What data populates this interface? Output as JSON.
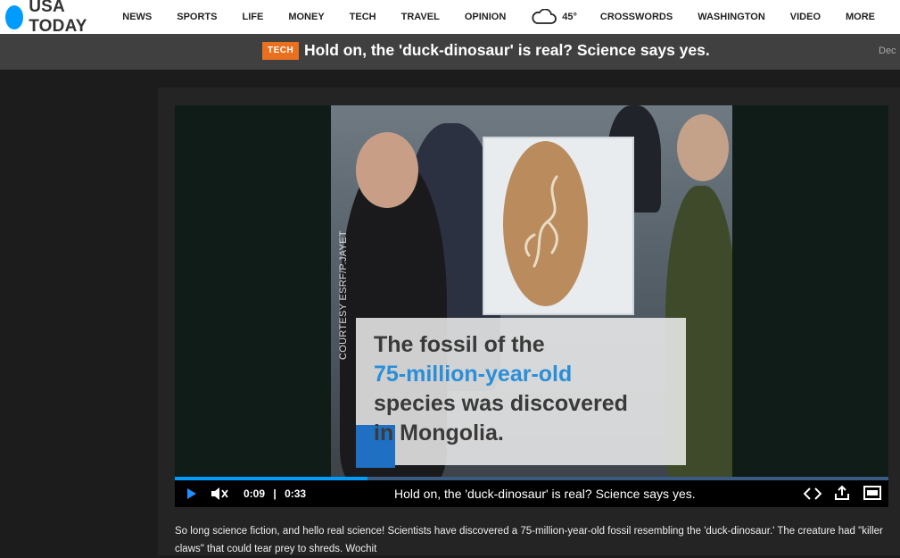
{
  "brand": {
    "name": "USA TODAY",
    "color": "#009bff"
  },
  "nav": {
    "items": [
      "NEWS",
      "SPORTS",
      "LIFE",
      "MONEY",
      "TECH",
      "TRAVEL",
      "OPINION"
    ],
    "weather": {
      "icon": "cloud-icon",
      "temp": "45°"
    },
    "items_after": [
      "CROSSWORDS",
      "WASHINGTON",
      "VIDEO",
      "MORE"
    ]
  },
  "headline_bar": {
    "tag": "TECH",
    "tag_color": "#e8701e",
    "title": "Hold on, the 'duck-dinosaur' is real? Science says yes.",
    "date": "Dec"
  },
  "video": {
    "credit": "COURTESY ESRF/P.JAYET",
    "caption": {
      "line1": "The fossil of the",
      "line2": "75-million-year-old",
      "line3": "species was discovered",
      "line4": "in Mongolia."
    },
    "controls": {
      "current_time": "0:09",
      "separator": "|",
      "duration": "0:33",
      "title": "Hold on, the 'duck-dinosaur' is real? Science says yes.",
      "progress": 0.27
    }
  },
  "description": "So long science fiction, and hello real science! Scientists have discovered a 75-million-year-old fossil resembling the 'duck-dinosaur.' The creature had \"killer claws\" that could tear prey to shreds. Wochit"
}
